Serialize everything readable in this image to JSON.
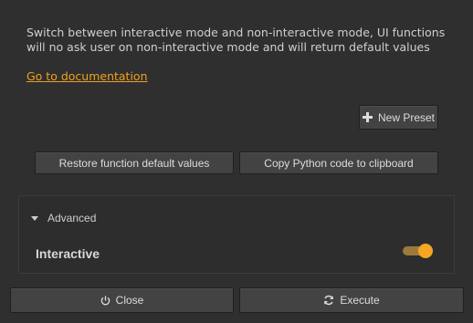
{
  "description": "Switch between interactive mode and non-interactive mode, UI functions will no ask user on non-interactive mode and will return default values",
  "doc_link": "Go to documentation",
  "buttons": {
    "new_preset": "New Preset",
    "restore_defaults": "Restore function default values",
    "copy_python": "Copy Python code to clipboard",
    "close": "Close",
    "execute": "Execute"
  },
  "advanced": {
    "title": "Advanced",
    "interactive_label": "Interactive",
    "interactive_enabled": true
  },
  "icons": {
    "new_preset": "plus-icon",
    "advanced_toggle": "triangle-down-icon",
    "close": "power-icon",
    "execute": "refresh-icon"
  },
  "colors": {
    "background": "#2f2f2f",
    "accent": "#f5a623",
    "link": "#f0a020",
    "button": "#434343"
  }
}
